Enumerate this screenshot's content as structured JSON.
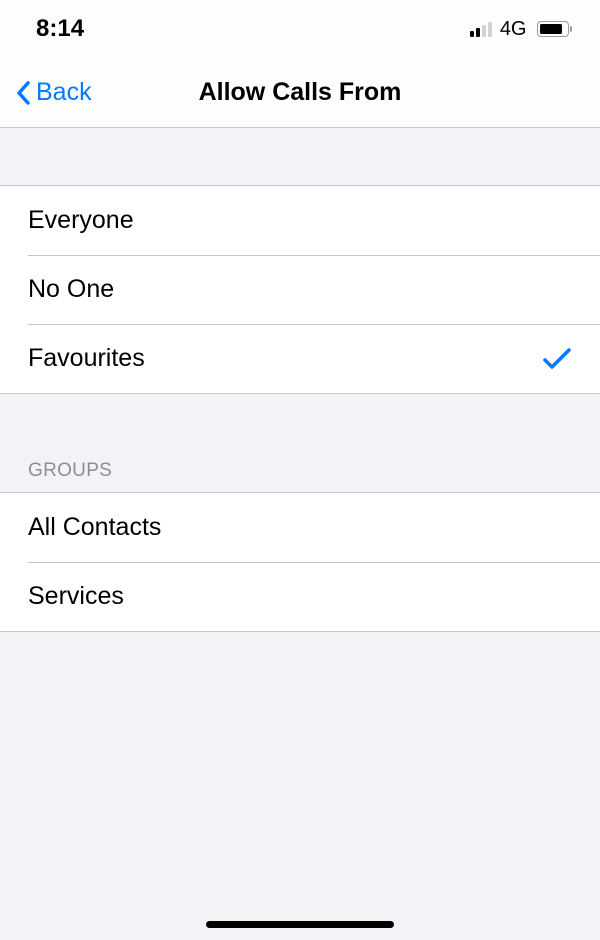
{
  "status": {
    "time": "8:14",
    "network_label": "4G"
  },
  "nav": {
    "back_label": "Back",
    "title": "Allow Calls From"
  },
  "section1": {
    "items": [
      {
        "label": "Everyone",
        "selected": false
      },
      {
        "label": "No One",
        "selected": false
      },
      {
        "label": "Favourites",
        "selected": true
      }
    ]
  },
  "section2": {
    "header": "GROUPS",
    "items": [
      {
        "label": "All Contacts",
        "selected": false
      },
      {
        "label": "Services",
        "selected": false
      }
    ]
  }
}
